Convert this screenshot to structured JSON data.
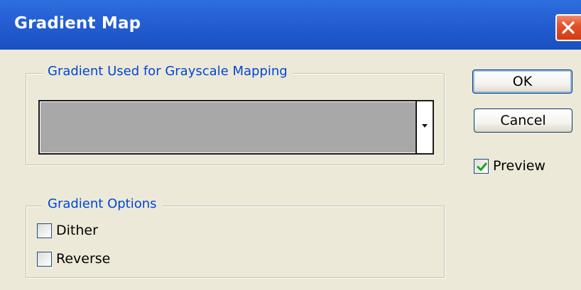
{
  "window": {
    "title": "Gradient Map",
    "close_icon": "close-icon",
    "titlebar_color": "#2661d5",
    "close_color": "#e2532c"
  },
  "gradient_group": {
    "label": "Gradient Used for Grayscale Mapping",
    "selected_gradient_color": "#a8a8a8",
    "dropdown_icon": "chevron-down-icon"
  },
  "options_group": {
    "label": "Gradient Options",
    "dither": {
      "label": "Dither",
      "checked": false
    },
    "reverse": {
      "label": "Reverse",
      "checked": false
    }
  },
  "buttons": {
    "ok_label": "OK",
    "cancel_label": "Cancel"
  },
  "preview": {
    "label": "Preview",
    "checked": true
  },
  "colors": {
    "dialog_bg": "#ece9d8",
    "group_label": "#0046d5",
    "check_mark": "#21a121"
  }
}
